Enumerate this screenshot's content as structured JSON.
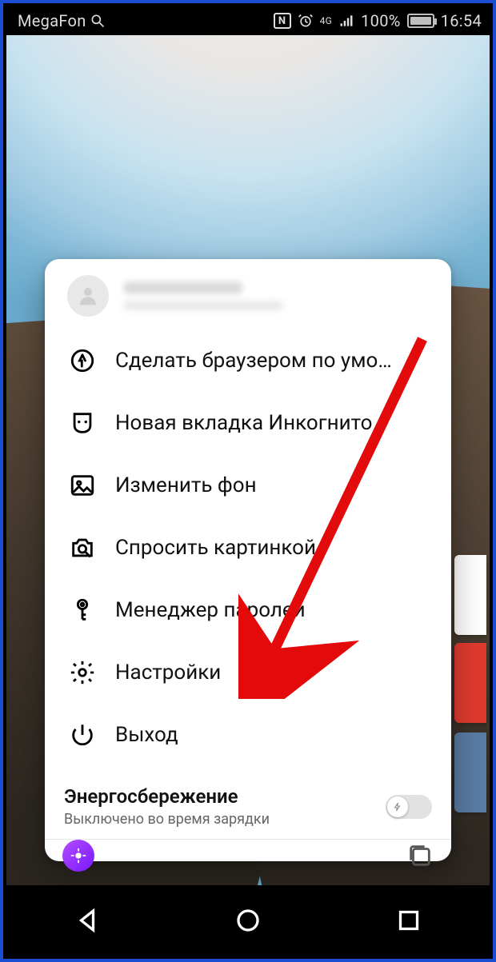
{
  "status": {
    "carrier": "MegaFon",
    "nfc": "N",
    "network_label": "4G",
    "battery_pct": "100%",
    "time": "16:54"
  },
  "menu": {
    "items": [
      {
        "label": "Сделать браузером по умо…"
      },
      {
        "label": "Новая вкладка Инкогнито"
      },
      {
        "label": "Изменить фон"
      },
      {
        "label": "Спросить картинкой"
      },
      {
        "label": "Менеджер паролей"
      },
      {
        "label": "Настройки"
      },
      {
        "label": "Выход"
      }
    ]
  },
  "energy": {
    "title": "Энергосбережение",
    "subtitle": "Выключено во время зарядки"
  }
}
